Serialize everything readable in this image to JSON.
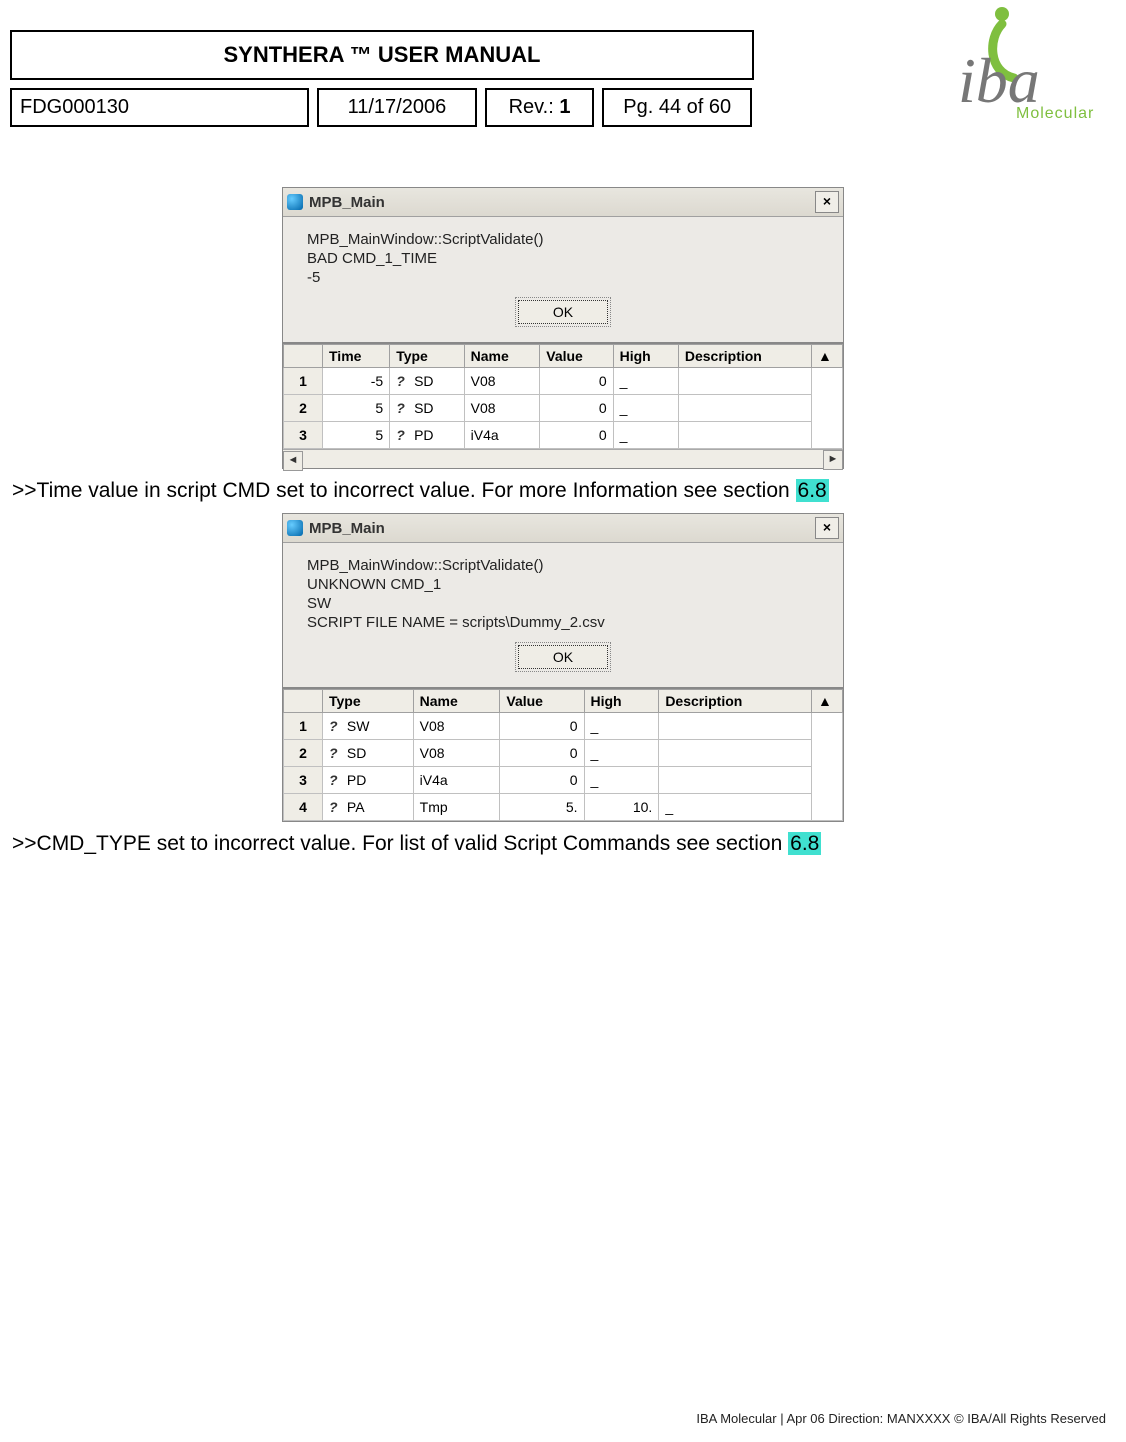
{
  "logo": {
    "brand_main": "iba",
    "brand_sub": "Molecular"
  },
  "header": {
    "title": "SYNTHERA ™ USER MANUAL",
    "doc_no": "FDG000130",
    "date": "11/17/2006",
    "rev_label": "Rev.:",
    "rev_value": "1",
    "page": "Pg. 44 of 60"
  },
  "shot1": {
    "title": "MPB_Main",
    "close": "×",
    "msg": [
      "MPB_MainWindow::ScriptValidate()",
      "BAD CMD_1_TIME",
      "-5"
    ],
    "ok": "OK",
    "columns": [
      "",
      "Time",
      "Type",
      "Name",
      "Value",
      "High",
      "Description"
    ],
    "rows": [
      {
        "n": "1",
        "time": "-5",
        "type": "SD",
        "name": "V08",
        "value": "0",
        "high": "_",
        "desc": ""
      },
      {
        "n": "2",
        "time": "5",
        "type": "SD",
        "name": "V08",
        "value": "0",
        "high": "_",
        "desc": ""
      },
      {
        "n": "3",
        "time": "5",
        "type": "PD",
        "name": "iV4a",
        "value": "0",
        "high": "_",
        "desc": ""
      }
    ]
  },
  "caption1": {
    "prefix": ">>Time value in script CMD set to incorrect value. For more Information see section ",
    "ref": "6.8"
  },
  "shot2": {
    "title": "MPB_Main",
    "close": "×",
    "msg": [
      "MPB_MainWindow::ScriptValidate()",
      "UNKNOWN CMD_1",
      "SW",
      "SCRIPT FILE NAME = scripts\\Dummy_2.csv"
    ],
    "ok": "OK",
    "columns": [
      "",
      "Type",
      "Name",
      "Value",
      "High",
      "Description"
    ],
    "rows": [
      {
        "n": "1",
        "type": "SW",
        "name": "V08",
        "value": "0",
        "high": "_",
        "desc": ""
      },
      {
        "n": "2",
        "type": "SD",
        "name": "V08",
        "value": "0",
        "high": "_",
        "desc": ""
      },
      {
        "n": "3",
        "type": "PD",
        "name": "iV4a",
        "value": "0",
        "high": "_",
        "desc": ""
      },
      {
        "n": "4",
        "type": "PA",
        "name": "Tmp",
        "value": "5.",
        "high": "10.",
        "desc": "_"
      }
    ]
  },
  "caption2": {
    "prefix": ">>CMD_TYPE set to incorrect value. For list of valid Script Commands see section ",
    "ref": "6.8"
  },
  "footer": "IBA Molecular | Apr 06 Direction: MANXXXX © IBA/All Rights Reserved"
}
